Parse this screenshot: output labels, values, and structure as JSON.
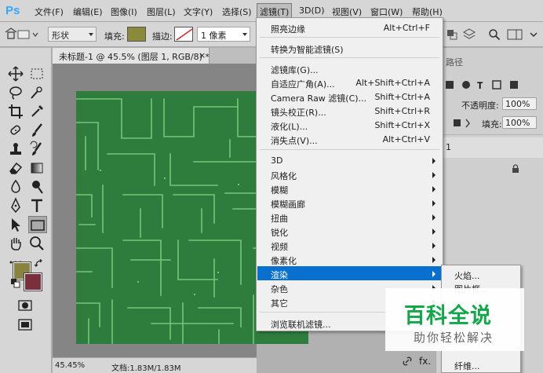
{
  "app": {
    "logo": "Ps"
  },
  "menubar": {
    "items": [
      {
        "label": "文件(F)"
      },
      {
        "label": "编辑(E)"
      },
      {
        "label": "图像(I)"
      },
      {
        "label": "图层(L)"
      },
      {
        "label": "文字(Y)"
      },
      {
        "label": "选择(S)"
      },
      {
        "label": "滤镜(T)",
        "active": true
      },
      {
        "label": "3D(D)"
      },
      {
        "label": "视图(V)"
      },
      {
        "label": "窗口(W)"
      },
      {
        "label": "帮助(H)"
      }
    ]
  },
  "options": {
    "shape_mode": "形状",
    "fill_label": "填充:",
    "fill_color": "#8a8a3a",
    "stroke_label": "描边:",
    "stroke_width": "1 像素"
  },
  "document": {
    "tab_title": "未标题-1 @ 45.5% (图层 1, RGB/8) *",
    "close": "×",
    "fill_color": "#2f7d3d",
    "line_color": "#76c57c"
  },
  "status": {
    "zoom": "45.45%",
    "doc_size": "文档:1.83M/1.83M"
  },
  "colors": {
    "foreground": "#8a8240",
    "background": "#7b2f3c"
  },
  "panels": {
    "tab_label": "路径",
    "opacity_label": "不透明度:",
    "opacity_value": "100%",
    "fill_label": "填充:",
    "fill_value": "100%",
    "layer_number": "1"
  },
  "filter_menu": {
    "groups": [
      [
        {
          "label": "照亮边缘",
          "shortcut": "Alt+Ctrl+F"
        }
      ],
      [
        {
          "label": "转换为智能滤镜(S)",
          "shortcut": ""
        }
      ],
      [
        {
          "label": "滤镜库(G)...",
          "shortcut": ""
        },
        {
          "label": "自适应广角(A)...",
          "shortcut": "Alt+Shift+Ctrl+A"
        },
        {
          "label": "Camera Raw 滤镜(C)...",
          "shortcut": "Shift+Ctrl+A"
        },
        {
          "label": "镜头校正(R)...",
          "shortcut": "Shift+Ctrl+R"
        },
        {
          "label": "液化(L)...",
          "shortcut": "Shift+Ctrl+X"
        },
        {
          "label": "消失点(V)...",
          "shortcut": "Alt+Ctrl+V"
        }
      ],
      [
        {
          "label": "3D",
          "submenu": true
        },
        {
          "label": "风格化",
          "submenu": true
        },
        {
          "label": "模糊",
          "submenu": true
        },
        {
          "label": "模糊画廊",
          "submenu": true
        },
        {
          "label": "扭曲",
          "submenu": true
        },
        {
          "label": "锐化",
          "submenu": true
        },
        {
          "label": "视频",
          "submenu": true
        },
        {
          "label": "像素化",
          "submenu": true
        },
        {
          "label": "渲染",
          "submenu": true,
          "highlighted": true
        },
        {
          "label": "杂色",
          "submenu": true
        },
        {
          "label": "其它",
          "submenu": true
        }
      ],
      [
        {
          "label": "浏览联机滤镜...",
          "shortcut": ""
        }
      ]
    ]
  },
  "render_submenu": {
    "items": [
      {
        "label": "火焰..."
      },
      {
        "label": "图片框..."
      },
      {
        "label": "纤维..."
      }
    ]
  },
  "watermark": {
    "main": "百科全说",
    "sub": "助你轻松解决"
  },
  "bottom_icons": {
    "fx": "fx."
  }
}
